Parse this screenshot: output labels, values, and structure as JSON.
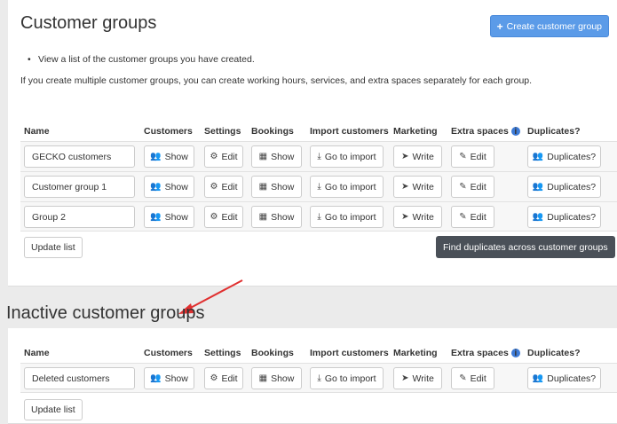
{
  "active": {
    "title": "Customer groups",
    "create_label": "Create customer group",
    "bullet": "View a list of the customer groups you have created.",
    "info": "If you create multiple customer groups, you can create working hours, services, and extra spaces separately for each group.",
    "headers": {
      "name": "Name",
      "customers": "Customers",
      "settings": "Settings",
      "bookings": "Bookings",
      "import": "Import customers",
      "marketing": "Marketing",
      "extra": "Extra spaces",
      "duplicates": "Duplicates?"
    },
    "rows": [
      {
        "name": "GECKO customers"
      },
      {
        "name": "Customer group 1"
      },
      {
        "name": "Group 2"
      }
    ],
    "update_label": "Update list",
    "dup_across_label": "Find duplicates across customer groups"
  },
  "inactive": {
    "title": "Inactive customer groups",
    "rows": [
      {
        "name": "Deleted customers"
      }
    ],
    "update_label": "Update list"
  },
  "buttons": {
    "show": "Show",
    "edit": "Edit",
    "go_import": "Go to import",
    "write": "Write",
    "duplicates": "Duplicates?"
  },
  "icons": {
    "users": "users-icon",
    "cog": "cog-icon",
    "calendar": "calendar-icon",
    "download": "download-icon",
    "send": "paper-plane-icon",
    "edit": "pencil-square-icon",
    "info": "info-icon",
    "plus": "plus-icon"
  },
  "colors": {
    "primary": "#5b9be8",
    "dark": "#4a5058",
    "arrow": "#e03030",
    "info": "#3c7ad6"
  }
}
